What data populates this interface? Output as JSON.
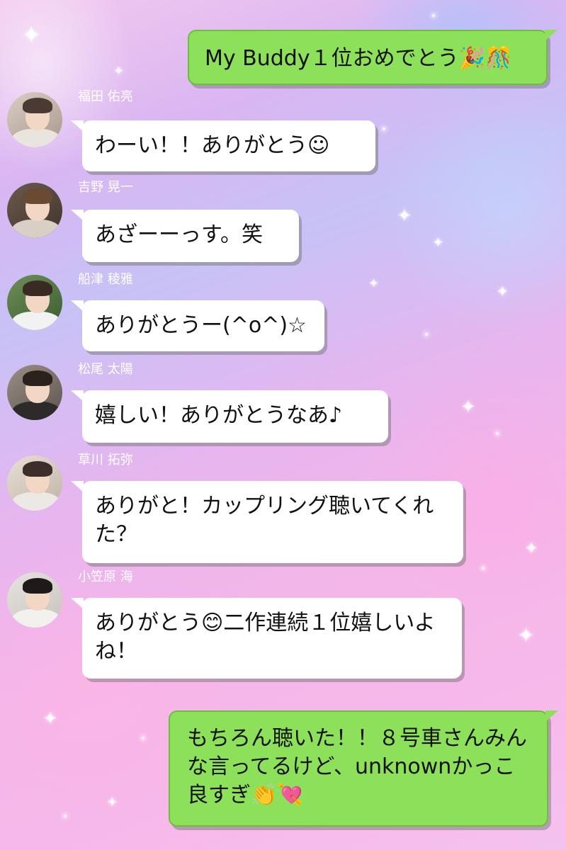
{
  "messages": {
    "sent_1": {
      "text": "My Buddy１位おめでとう🎉🎊"
    },
    "recv_1": {
      "name": "福田 佑亮",
      "text": "わーい！！ありがとう☺"
    },
    "recv_2": {
      "name": "吉野 晃一",
      "text": "あざーーっす。笑"
    },
    "recv_3": {
      "name": "船津 稜雅",
      "text": "ありがとうー(^o^)☆"
    },
    "recv_4": {
      "name": "松尾 太陽",
      "text": "嬉しい！ありがとうなあ♪"
    },
    "recv_5": {
      "name": "草川 拓弥",
      "text": "ありがと！カップリング聴いてくれた？"
    },
    "recv_6": {
      "name": "小笠原 海",
      "text": "ありがとう😊二作連続１位嬉しいよね！"
    },
    "sent_2": {
      "text": "もちろん聴いた！！８号車さんみんな言ってるけど、unknownかっこ良すぎ👏💘"
    }
  },
  "colors": {
    "sent_bubble": "#8de05a",
    "recv_bubble": "#ffffff",
    "name_text": "#ffffff"
  }
}
